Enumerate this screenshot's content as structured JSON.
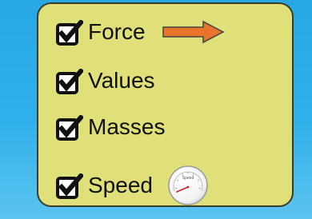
{
  "panel": {
    "items": [
      {
        "label": "Force",
        "checked": true,
        "icon": "force-arrow-icon",
        "icon_color": "#e8742b"
      },
      {
        "label": "Values",
        "checked": true
      },
      {
        "label": "Masses",
        "checked": true
      },
      {
        "label": "Speed",
        "checked": true,
        "icon": "speedometer-icon",
        "speedometer_label": "Speed"
      }
    ]
  },
  "colors": {
    "background": "#2fb0ea",
    "panel": "#dfe07a",
    "panel_border": "#3b3b2a",
    "arrow": "#e8742b",
    "needle": "#d0202a"
  }
}
